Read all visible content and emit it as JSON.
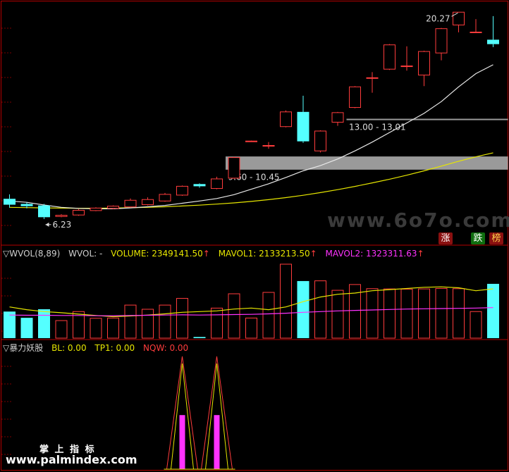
{
  "colors": {
    "up": "#ff3c3c",
    "down": "#54ffff",
    "ma_fast": "#e8e8e8",
    "ma_slow": "#e6e600",
    "mavol1": "#e6e600",
    "mavol2": "#ff32ff",
    "zone": "#9a9a9a",
    "yoshi": "#ff32ff"
  },
  "price_panel": {
    "high_label": "20.27",
    "low_label": "6.23",
    "zone_low_label": "9.60 - 10.45",
    "zone_high_label": "13.00 - 13.01",
    "watermark": "www.6o7o.com",
    "badges": {
      "up": "涨",
      "down": "跌",
      "rank": "榜"
    }
  },
  "vol_panel": {
    "name": "WVOL(8,89)",
    "vol_label": "WVOL: -",
    "volume_label": "VOLUME: 2349141.50",
    "mavol1_label": "MAVOL1: 2133213.50",
    "mavol2_label": "MAVOL2: 1323311.63"
  },
  "ind_panel": {
    "name": "暴力妖股",
    "bl_label": "BL: 0.00",
    "tp1_label": "TP1: 0.00",
    "nqw_label": "NQW: 0.00",
    "watermark_cn": "掌 上 指 标",
    "watermark_url": "www.palmindex.com"
  },
  "chart_data": {
    "type": "candlestick",
    "bar_count": 29,
    "price_range": [
      4.5,
      21.0
    ],
    "candles": [
      {
        "o": 7.6,
        "c": 7.2,
        "h": 7.9,
        "l": 7.0
      },
      {
        "o": 7.25,
        "c": 7.1,
        "h": 7.35,
        "l": 6.95
      },
      {
        "o": 7.15,
        "c": 6.35,
        "h": 7.25,
        "l": 6.23
      },
      {
        "o": 6.4,
        "c": 6.48,
        "h": 6.55,
        "l": 6.35
      },
      {
        "o": 6.5,
        "c": 6.82,
        "h": 6.9,
        "l": 6.45
      },
      {
        "o": 6.8,
        "c": 6.97,
        "h": 7.02,
        "l": 6.76
      },
      {
        "o": 6.95,
        "c": 7.1,
        "h": 7.15,
        "l": 6.9
      },
      {
        "o": 7.05,
        "c": 7.5,
        "h": 7.62,
        "l": 7.0
      },
      {
        "o": 7.2,
        "c": 7.55,
        "h": 7.7,
        "l": 7.15
      },
      {
        "o": 7.45,
        "c": 7.9,
        "h": 8.0,
        "l": 7.4
      },
      {
        "o": 7.85,
        "c": 8.45,
        "h": 8.5,
        "l": 7.8
      },
      {
        "o": 8.6,
        "c": 8.45,
        "h": 8.65,
        "l": 8.35
      },
      {
        "o": 8.3,
        "c": 8.95,
        "h": 9.1,
        "l": 8.25
      },
      {
        "o": 9.0,
        "c": 10.4,
        "h": 10.45,
        "l": 8.95
      },
      {
        "o": 11.5,
        "c": 11.52,
        "h": 11.55,
        "l": 11.5
      },
      {
        "o": 11.2,
        "c": 11.22,
        "h": 11.45,
        "l": 11.0
      },
      {
        "o": 12.5,
        "c": 13.5,
        "h": 13.6,
        "l": 12.45
      },
      {
        "o": 13.5,
        "c": 11.5,
        "h": 14.6,
        "l": 11.4
      },
      {
        "o": 10.85,
        "c": 12.2,
        "h": 12.25,
        "l": 10.75
      },
      {
        "o": 12.8,
        "c": 13.45,
        "h": 13.5,
        "l": 12.55
      },
      {
        "o": 13.8,
        "c": 15.2,
        "h": 15.25,
        "l": 13.75
      },
      {
        "o": 15.8,
        "c": 15.82,
        "h": 16.2,
        "l": 14.8
      },
      {
        "o": 16.4,
        "c": 18.05,
        "h": 18.1,
        "l": 16.35
      },
      {
        "o": 16.6,
        "c": 16.62,
        "h": 17.95,
        "l": 16.3
      },
      {
        "o": 16.0,
        "c": 17.6,
        "h": 17.65,
        "l": 15.25
      },
      {
        "o": 17.5,
        "c": 19.15,
        "h": 19.2,
        "l": 17.0
      },
      {
        "o": 19.4,
        "c": 20.27,
        "h": 20.27,
        "l": 18.9
      },
      {
        "o": 18.9,
        "c": 18.92,
        "h": 19.8,
        "l": 18.9
      },
      {
        "o": 18.4,
        "c": 18.1,
        "h": 20.0,
        "l": 17.9
      }
    ],
    "ma_fast": [
      7.45,
      7.36,
      7.18,
      7.02,
      6.95,
      6.92,
      6.92,
      6.98,
      7.06,
      7.15,
      7.3,
      7.45,
      7.62,
      7.88,
      8.25,
      8.62,
      9.05,
      9.5,
      9.85,
      10.3,
      10.85,
      11.45,
      12.1,
      12.75,
      13.4,
      14.2,
      15.2,
      16.1,
      16.7
    ],
    "ma_slow": [
      7.02,
      7.0,
      6.98,
      6.97,
      6.96,
      6.96,
      6.97,
      6.99,
      7.02,
      7.06,
      7.11,
      7.17,
      7.24,
      7.32,
      7.42,
      7.54,
      7.68,
      7.84,
      8.02,
      8.22,
      8.44,
      8.68,
      8.93,
      9.2,
      9.5,
      9.82,
      10.15,
      10.45,
      10.72
    ],
    "zones": [
      {
        "low": 9.6,
        "high": 10.45
      },
      {
        "low": 13.0,
        "high": 13.01
      }
    ],
    "volume": {
      "range": [
        0,
        3200000
      ],
      "values": [
        1150000,
        880000,
        1250000,
        760000,
        1150000,
        860000,
        870000,
        1430000,
        1250000,
        1430000,
        1720000,
        50000,
        1300000,
        1920000,
        870000,
        1980000,
        3200000,
        2470000,
        2480000,
        2070000,
        2320000,
        2140000,
        2130000,
        2120000,
        2130000,
        2150000,
        2140000,
        1150000,
        2349141.5
      ],
      "mavol1": [
        1350000,
        1230000,
        1150000,
        1100000,
        1040000,
        980000,
        930000,
        960000,
        1000000,
        1050000,
        1120000,
        1150000,
        1180000,
        1260000,
        1300000,
        1230000,
        1350000,
        1580000,
        1780000,
        1900000,
        1950000,
        2050000,
        2100000,
        2150000,
        2200000,
        2220000,
        2180000,
        2050000,
        2133213.5
      ],
      "mavol2": [
        1000000,
        990000,
        990000,
        980000,
        980000,
        970000,
        970000,
        980000,
        990000,
        1000000,
        1010000,
        1000000,
        1010000,
        1020000,
        1030000,
        1050000,
        1080000,
        1120000,
        1150000,
        1180000,
        1200000,
        1220000,
        1240000,
        1260000,
        1270000,
        1280000,
        1290000,
        1300000,
        1323311.63
      ]
    },
    "yoshi": {
      "range": [
        0,
        1
      ],
      "signals": [
        {
          "bar": 10,
          "value": 1.0,
          "strength": 0.48
        },
        {
          "bar": 12,
          "value": 1.0,
          "strength": 0.48
        }
      ]
    }
  }
}
